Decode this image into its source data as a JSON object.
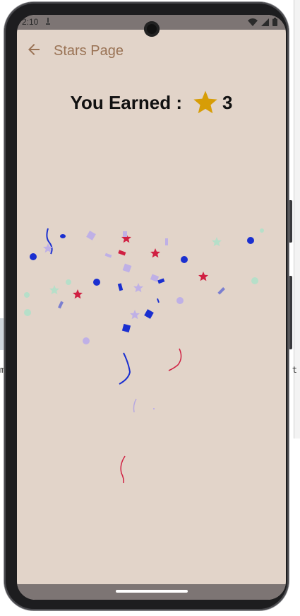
{
  "status_bar": {
    "time": "2:10"
  },
  "app_bar": {
    "title": "Stars Page",
    "back_icon": "arrow-back-icon"
  },
  "earned": {
    "label": "You Earned :",
    "star_icon": "star-icon",
    "star_color": "#d79d06",
    "count": "3"
  },
  "colors": {
    "background": "#e2d4c9",
    "title": "#9a7355",
    "status_bar": "#7d7574"
  }
}
